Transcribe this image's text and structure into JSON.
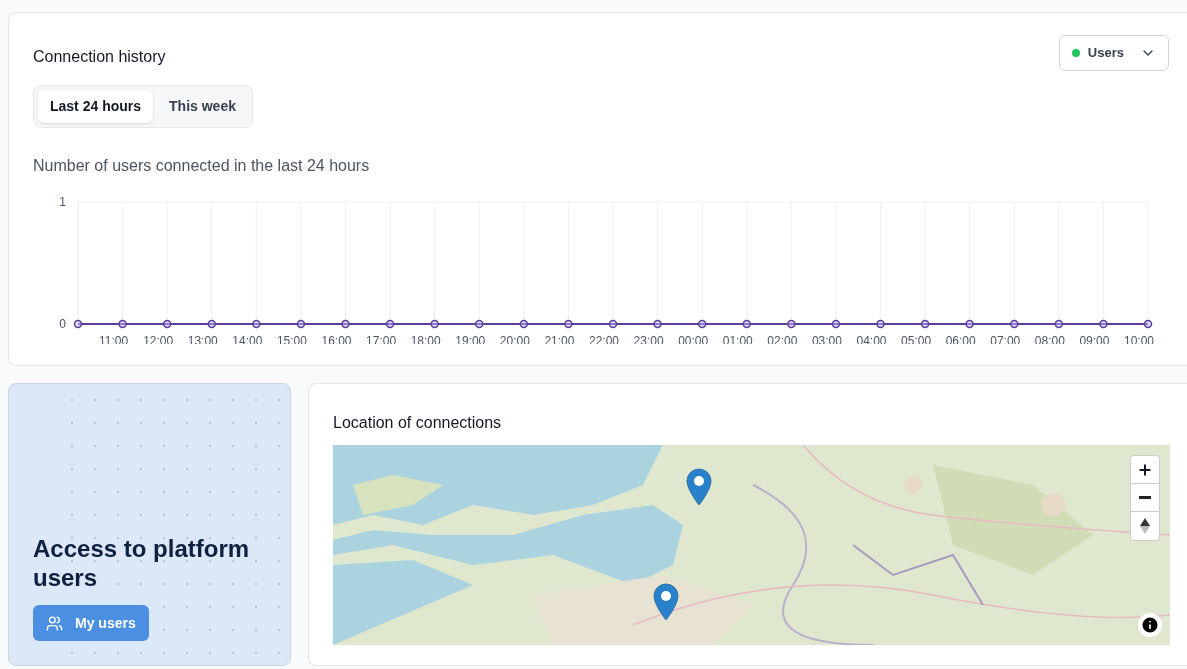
{
  "history": {
    "title": "Connection history",
    "filter": {
      "label": "Users",
      "color": "#22c55e"
    },
    "tabs": [
      {
        "label": "Last 24 hours",
        "selected": true
      },
      {
        "label": "This week",
        "selected": false
      }
    ],
    "chart_title": "Number of users connected in the last 24 hours",
    "chart_data": {
      "type": "line",
      "categories": [
        null,
        "11:00",
        "12:00",
        "13:00",
        "14:00",
        "15:00",
        "16:00",
        "17:00",
        "18:00",
        "19:00",
        "20:00",
        "21:00",
        "22:00",
        "23:00",
        "00:00",
        "01:00",
        "02:00",
        "03:00",
        "04:00",
        "05:00",
        "06:00",
        "07:00",
        "08:00",
        "09:00",
        "10:00"
      ],
      "series": [
        {
          "color": "#5b3f9a",
          "marker": true,
          "values": [
            0,
            0,
            0,
            0,
            0,
            0,
            0,
            0,
            0,
            0,
            0,
            0,
            0,
            0,
            0,
            0,
            0,
            0,
            0,
            0,
            0,
            0,
            0,
            0,
            0
          ]
        }
      ],
      "ylim": [
        0,
        1
      ],
      "yticks": [
        0,
        1
      ]
    }
  },
  "access": {
    "title": "Access to platform users",
    "button": "My users"
  },
  "map": {
    "title": "Location of connections"
  }
}
